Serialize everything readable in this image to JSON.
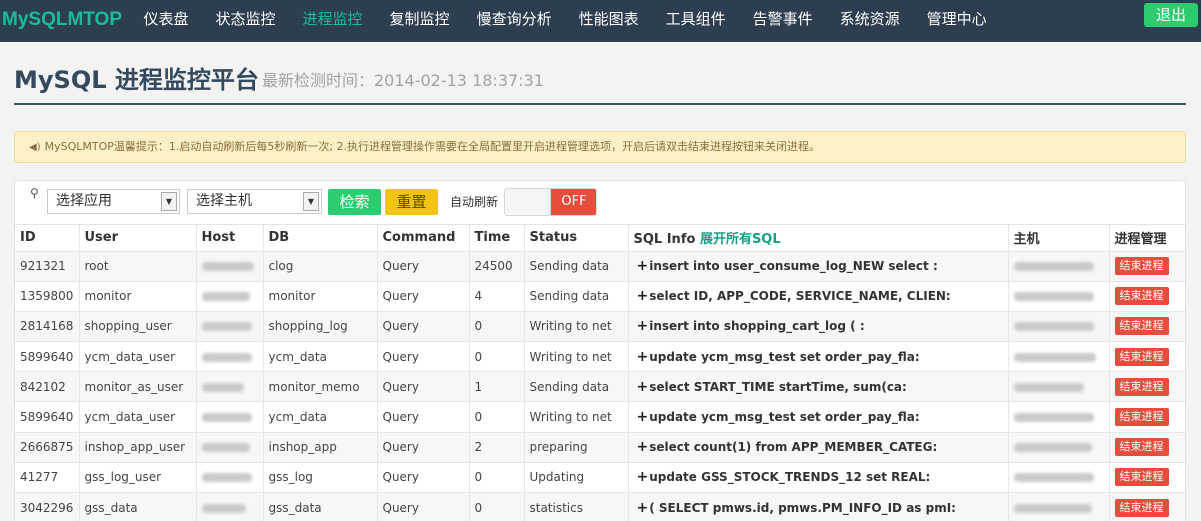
{
  "brand": "MySQLMTOP",
  "nav": [
    "仪表盘",
    "状态监控",
    "进程监控",
    "复制监控",
    "慢查询分析",
    "性能图表",
    "工具组件",
    "告警事件",
    "系统资源",
    "管理中心"
  ],
  "nav_active_index": 2,
  "logout_label": "退出",
  "page": {
    "title": "MySQL 进程监控平台",
    "last_check": "最新检测时间：2014-02-13 18:37:31"
  },
  "notice": "MySQLMTOP温馨提示：1.启动自动刷新后每5秒刷新一次; 2.执行进程管理操作需要在全局配置里开启进程管理选项，开启后请双击结束进程按钮来关闭进程。",
  "filters": {
    "app_select": "选择应用",
    "host_select": "选择主机",
    "search_button": "检索",
    "reset_button": "重置",
    "auto_refresh_label": "自动刷新",
    "toggle_state": "OFF"
  },
  "table": {
    "headers": {
      "id": "ID",
      "user": "User",
      "host": "Host",
      "db": "DB",
      "command": "Command",
      "time": "Time",
      "status": "Status",
      "sql_info": "SQL Info",
      "expand_all": "展开所有SQL",
      "server": "主机",
      "manage": "进程管理"
    },
    "kill_label": "结束进程",
    "rows": [
      {
        "id": "921321",
        "user": "root",
        "db": "clog",
        "command": "Query",
        "time": "24500",
        "status": "Sending data",
        "sql": "insert into user_consume_log_NEW select :"
      },
      {
        "id": "1359800",
        "user": "monitor",
        "db": "monitor",
        "command": "Query",
        "time": "4",
        "status": "Sending data",
        "sql": "select ID, APP_CODE, SERVICE_NAME, CLIEN:"
      },
      {
        "id": "2814168",
        "user": "shopping_user",
        "db": "shopping_log",
        "command": "Query",
        "time": "0",
        "status": "Writing to net",
        "sql": "insert into shopping_cart_log ( :"
      },
      {
        "id": "5899640",
        "user": "ycm_data_user",
        "db": "ycm_data",
        "command": "Query",
        "time": "0",
        "status": "Writing to net",
        "sql": "update ycm_msg_test set order_pay_fla:"
      },
      {
        "id": "842102",
        "user": "monitor_as_user",
        "db": "monitor_memo",
        "command": "Query",
        "time": "1",
        "status": "Sending data",
        "sql": "select START_TIME startTime, sum(ca:"
      },
      {
        "id": "5899640",
        "user": "ycm_data_user",
        "db": "ycm_data",
        "command": "Query",
        "time": "0",
        "status": "Writing to net",
        "sql": "update ycm_msg_test set order_pay_fla:"
      },
      {
        "id": "2666875",
        "user": "inshop_app_user",
        "db": "inshop_app",
        "command": "Query",
        "time": "2",
        "status": "preparing",
        "sql": "select count(1) from APP_MEMBER_CATEG:"
      },
      {
        "id": "41277",
        "user": "gss_log_user",
        "db": "gss_log",
        "command": "Query",
        "time": "0",
        "status": "Updating",
        "sql": "update GSS_STOCK_TRENDS_12 set REAL:"
      },
      {
        "id": "3042296",
        "user": "gss_data",
        "db": "gss_data",
        "command": "Query",
        "time": "0",
        "status": "statistics",
        "sql": "( SELECT pmws.id, pmws.PM_INFO_ID as pmI:"
      }
    ]
  }
}
